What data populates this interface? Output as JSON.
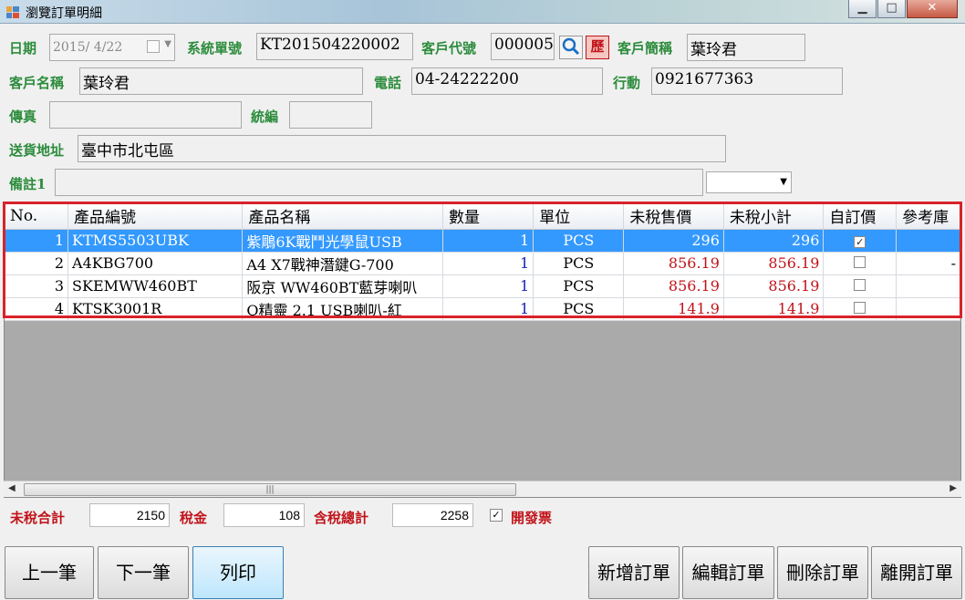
{
  "window": {
    "title": "瀏覽訂單明細",
    "minimize": "▁",
    "maximize": "□",
    "close": "✕"
  },
  "form": {
    "date_label": "日期",
    "date_value": "2015/ 4/22",
    "order_no_label": "系統單號",
    "order_no": "KT201504220002",
    "customer_code_label": "客戶代號",
    "customer_code": "000005",
    "history_button": "歷",
    "short_name_label": "客戶簡稱",
    "short_name": "葉玲君",
    "customer_name_label": "客戶名稱",
    "customer_name": "葉玲君",
    "phone_label": "電話",
    "phone": "04-24222200",
    "mobile_label": "行動",
    "mobile": "0921677363",
    "fax_label": "傳真",
    "fax": "",
    "tax_id_label": "統編",
    "tax_id": "",
    "address_label": "送貨地址",
    "address": "臺中市北屯區",
    "note_label": "備註1",
    "note": "",
    "note_option": ""
  },
  "grid": {
    "columns": [
      "No.",
      "產品編號",
      "產品名稱",
      "數量",
      "單位",
      "未稅售價",
      "未稅小計",
      "自訂價",
      "參考庫"
    ],
    "rows": [
      {
        "no": "1",
        "code": "KTMS5503UBK",
        "name": "紫鵰6K戰鬥光學鼠USB",
        "qty": "1",
        "unit": "PCS",
        "price": "296",
        "subtotal": "296",
        "custom": true,
        "ref": ""
      },
      {
        "no": "2",
        "code": "A4KBG700",
        "name": "A4 X7戰神潛鍵G-700",
        "qty": "1",
        "unit": "PCS",
        "price": "856.19",
        "subtotal": "856.19",
        "custom": false,
        "ref": "-"
      },
      {
        "no": "3",
        "code": "SKEMWW460BT",
        "name": "阪京 WW460BT藍芽喇叭",
        "qty": "1",
        "unit": "PCS",
        "price": "856.19",
        "subtotal": "856.19",
        "custom": false,
        "ref": ""
      },
      {
        "no": "4",
        "code": "KTSK3001R",
        "name": "Q精靈 2.1 USB喇叭-紅",
        "qty": "1",
        "unit": "PCS",
        "price": "141.9",
        "subtotal": "141.9",
        "custom": false,
        "ref": ""
      }
    ],
    "scroll_grip": "|||"
  },
  "totals": {
    "untaxed_label": "未稅合計",
    "untaxed": "2150",
    "tax_label": "稅金",
    "tax": "108",
    "total_label": "含稅總計",
    "total": "2258",
    "invoice_label": "開發票",
    "invoice_checked": true
  },
  "buttons": {
    "prev": "上一筆",
    "next": "下一筆",
    "print": "列印",
    "add": "新增訂單",
    "edit": "編輯訂單",
    "delete": "刪除訂單",
    "exit": "離開訂單"
  },
  "colors": {
    "label_green": "#2c8c3c",
    "label_red": "#c0141a",
    "selection": "#3399ff",
    "outline": "#d8232a"
  }
}
